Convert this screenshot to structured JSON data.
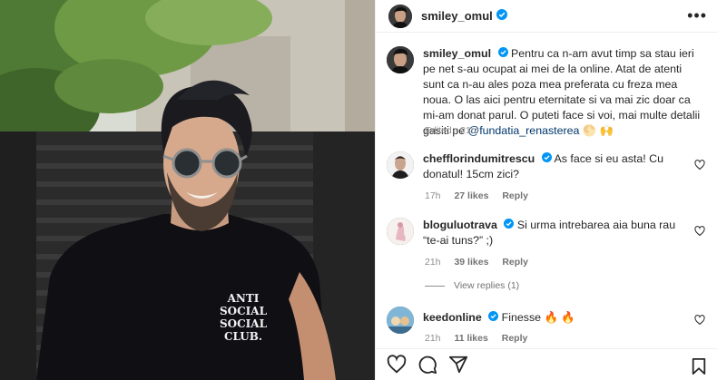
{
  "post": {
    "author": "smiley_omul",
    "caption_pre": "Pentru ca n-am avut timp sa stau ieri pe net s-au ocupat ai mei de la online. Atat de atenti sunt ca n-au ales poza mea preferata cu freza mea noua. O las aici pentru eternitate si va mai zic doar ca mi-am donat parul. O puteti face si voi, mai multe detalii gasiti pe",
    "caption_tag": "@fundatia_renasterea",
    "caption_emoji": "🌕 🙌",
    "edited": "Edited · 21h",
    "shirt_text": [
      "ANTI",
      "SOCIAL",
      "SOCIAL",
      "CLUB."
    ]
  },
  "header": {
    "username": "smiley_omul",
    "more": "•••"
  },
  "comments": [
    {
      "user": "chefflorindumitrescu",
      "text": "As face si eu asta! Cu donatul! 15cm zici?",
      "time": "17h",
      "likes": "27 likes",
      "reply": "Reply"
    },
    {
      "user": "bloguluotrava",
      "text": "Si urma intrebarea aia buna rau “te-ai tuns?” ;)",
      "time": "21h",
      "likes": "39 likes",
      "reply": "Reply"
    },
    {
      "user": "keedonline",
      "text": "Finesse 🔥 🔥",
      "time": "21h",
      "likes": "11 likes",
      "reply": "Reply"
    }
  ],
  "view_replies": "View replies (1)",
  "icons": {
    "like": "heart-icon",
    "comment": "comment-icon",
    "share": "send-icon",
    "save": "bookmark-icon",
    "verified": "verified-badge-icon"
  },
  "colors": {
    "verified": "#0095f6",
    "link": "#00376b",
    "muted": "#8e8e8e"
  }
}
